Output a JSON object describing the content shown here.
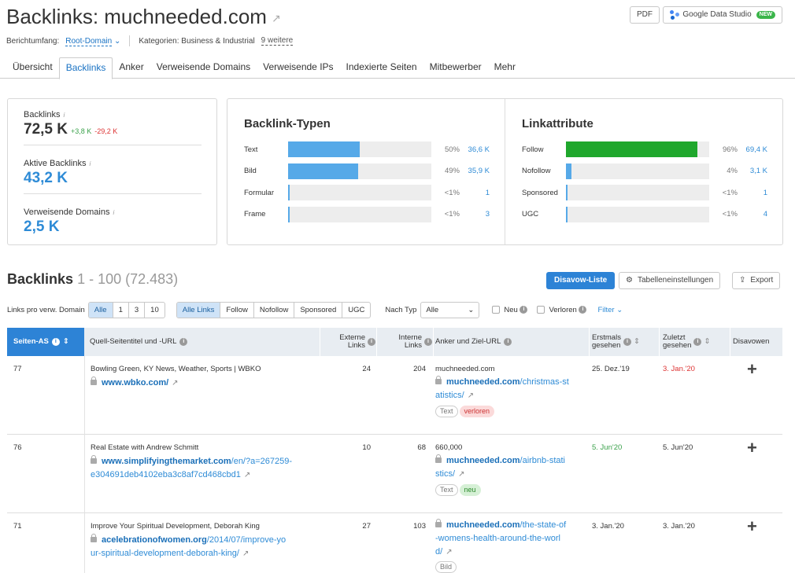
{
  "header": {
    "title": "Backlinks: muchneeded.com",
    "pdf_label": "PDF",
    "gds_label": "Google Data Studio",
    "gds_badge": "NEW",
    "scope_label": "Berichtumfang:",
    "scope_value": "Root-Domain",
    "categories_label": "Kategorien: Business & Industrial",
    "categories_more": "9 weitere"
  },
  "tabs": [
    "Übersicht",
    "Backlinks",
    "Anker",
    "Verweisende Domains",
    "Verweisende IPs",
    "Indexierte Seiten",
    "Mitbewerber",
    "Mehr"
  ],
  "stats": {
    "backlinks": {
      "label": "Backlinks",
      "value": "72,5 K",
      "up": "+3,8 K",
      "down": "-29,2 K"
    },
    "active": {
      "label": "Aktive Backlinks",
      "value": "43,2 K"
    },
    "domains": {
      "label": "Verweisende Domains",
      "value": "2,5 K"
    }
  },
  "types": {
    "title": "Backlink-Typen",
    "rows": [
      {
        "name": "Text",
        "pct": "50%",
        "num": "36,6 K",
        "fill": 0.5
      },
      {
        "name": "Bild",
        "pct": "49%",
        "num": "35,9 K",
        "fill": 0.49
      },
      {
        "name": "Formular",
        "pct": "<1%",
        "num": "1",
        "fill": 0.01
      },
      {
        "name": "Frame",
        "pct": "<1%",
        "num": "3",
        "fill": 0.01
      }
    ]
  },
  "attrs": {
    "title": "Linkattribute",
    "rows": [
      {
        "name": "Follow",
        "pct": "96%",
        "num": "69,4 K",
        "fill": 0.92
      },
      {
        "name": "Nofollow",
        "pct": "4%",
        "num": "3,1 K",
        "fill": 0.04
      },
      {
        "name": "Sponsored",
        "pct": "<1%",
        "num": "1",
        "fill": 0.01
      },
      {
        "name": "UGC",
        "pct": "<1%",
        "num": "4",
        "fill": 0.01
      }
    ]
  },
  "colors": {
    "blue_bar": "#56a9e8",
    "green_bar": "#1fa72c",
    "accent": "#2d83d6"
  },
  "list": {
    "title": "Backlinks",
    "range": "1 - 100 (72.483)",
    "disavow_btn": "Disavow-Liste",
    "table_settings_btn": "Tabelleneinstellungen",
    "export_btn": "Export"
  },
  "filters": {
    "per_domain_label": "Links pro verw. Domain",
    "per_domain_options": [
      "Alle",
      "1",
      "3",
      "10"
    ],
    "link_types": [
      "Alle Links",
      "Follow",
      "Nofollow",
      "Sponsored",
      "UGC"
    ],
    "type_label": "Nach Typ",
    "type_value": "Alle",
    "new_label": "Neu",
    "lost_label": "Verloren",
    "filter_label": "Filter"
  },
  "columns": {
    "as": "Seiten-AS",
    "source": "Quell-Seitentitel und -URL",
    "ext_1": "Externe",
    "ext_2": "Links",
    "int_1": "Interne",
    "int_2": "Links",
    "anchor": "Anker und Ziel-URL",
    "first_1": "Erstmals",
    "first_2": "gesehen",
    "last_1": "Zuletzt",
    "last_2": "gesehen",
    "disavow": "Disavowen"
  },
  "rows": [
    {
      "as": "77",
      "title": "Bowling Green, KY News, Weather, Sports | WBKO",
      "url_bold": "www.wbko.com/",
      "url_rest": "",
      "url_line2": "",
      "ext": "24",
      "int": "204",
      "anchor": "muchneeded.com",
      "target_bold": "muchneeded.com",
      "target_rest": "/christmas-st",
      "target_line2": "atistics/",
      "target_line3": "",
      "tags": [
        "Text",
        "verloren"
      ],
      "first": "25. Dez.'19",
      "last": "3. Jan.'20"
    },
    {
      "as": "76",
      "title": "Real Estate with Andrew Schmitt",
      "url_bold": "www.simplifyingthemarket.com",
      "url_rest": "/en/?a=267259-",
      "url_line2": "e304691deb4102eba3c8af7cd468cbd1",
      "ext": "10",
      "int": "68",
      "anchor": "660,000",
      "target_bold": "muchneeded.com",
      "target_rest": "/airbnb-stati",
      "target_line2": "stics/",
      "target_line3": "",
      "tags": [
        "Text",
        "neu"
      ],
      "first": "5. Jun'20",
      "last": "5. Jun'20"
    },
    {
      "as": "71",
      "title": "Improve Your Spiritual Development, Deborah King",
      "url_bold": "acelebrationofwomen.org",
      "url_rest": "/2014/07/improve-yo",
      "url_line2": "ur-spiritual-development-deborah-king/",
      "ext": "27",
      "int": "103",
      "anchor": "",
      "target_bold": "muchneeded.com",
      "target_rest": "/the-state-of",
      "target_line2": "-womens-health-around-the-worl",
      "target_line3": "d/",
      "tags": [
        "Bild"
      ],
      "first": "3. Jan.'20",
      "last": "3. Jan.'20"
    }
  ],
  "disavow_symbol": "+"
}
